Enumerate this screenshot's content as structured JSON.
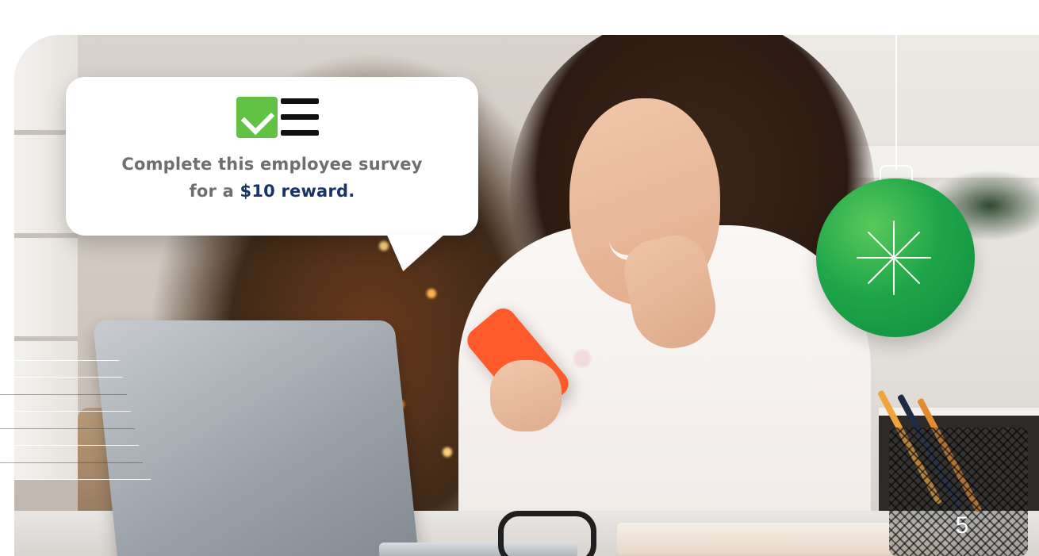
{
  "bubble": {
    "line1": "Complete this employee survey",
    "line2_prefix": "for a ",
    "line2_reward": "$10 reward."
  },
  "page_number": "5",
  "icons": {
    "checklist": "checklist-icon",
    "ornament_sparkle": "sparkle-icon"
  },
  "colors": {
    "reward_text": "#183366",
    "body_text": "#6f6f6f",
    "check_green": "#62c244",
    "ornament_green": "#1ea64a",
    "phone_orange": "#ff5a2a"
  }
}
